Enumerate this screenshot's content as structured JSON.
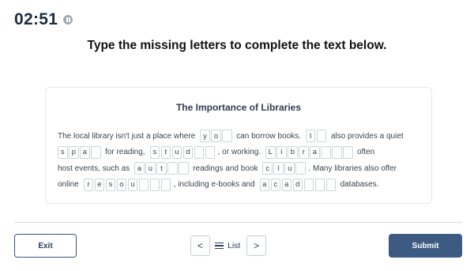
{
  "timer": {
    "value": "02:51",
    "icon": "pause-icon"
  },
  "instruction": "Type the missing letters to complete the text below.",
  "card": {
    "title": "The Importance of Libraries",
    "lines": [
      [
        {
          "t": "The local library isn't just a place where"
        },
        {
          "w": [
            "y",
            "o",
            ""
          ]
        },
        {
          "t": "can borrow books."
        },
        {
          "w": [
            "I",
            ""
          ]
        },
        {
          "t": "also provides a quiet"
        }
      ],
      [
        {
          "w": [
            "s",
            "p",
            "a",
            ""
          ]
        },
        {
          "t": "for reading,"
        },
        {
          "w": [
            "s",
            "t",
            "u",
            "d",
            "",
            ""
          ]
        },
        {
          "t": ", or working."
        },
        {
          "w": [
            "L",
            "i",
            "b",
            "r",
            "a",
            "",
            "",
            ""
          ]
        },
        {
          "t": "often"
        }
      ],
      [
        {
          "t": "host events, such as"
        },
        {
          "w": [
            "a",
            "u",
            "t",
            "",
            ""
          ]
        },
        {
          "t": "readings and book"
        },
        {
          "w": [
            "c",
            "l",
            "u",
            ""
          ]
        },
        {
          "t": ". Many libraries also offer"
        }
      ],
      [
        {
          "t": "online"
        },
        {
          "w": [
            "r",
            "e",
            "s",
            "o",
            "u",
            "",
            "",
            ""
          ]
        },
        {
          "t": ", including e-books and"
        },
        {
          "w": [
            "a",
            "c",
            "a",
            "d",
            "",
            "",
            ""
          ]
        },
        {
          "t": "databases."
        }
      ]
    ]
  },
  "footer": {
    "exit_label": "Exit",
    "prev_label": "<",
    "list_label": "List",
    "next_label": ">",
    "submit_label": "Submit"
  }
}
